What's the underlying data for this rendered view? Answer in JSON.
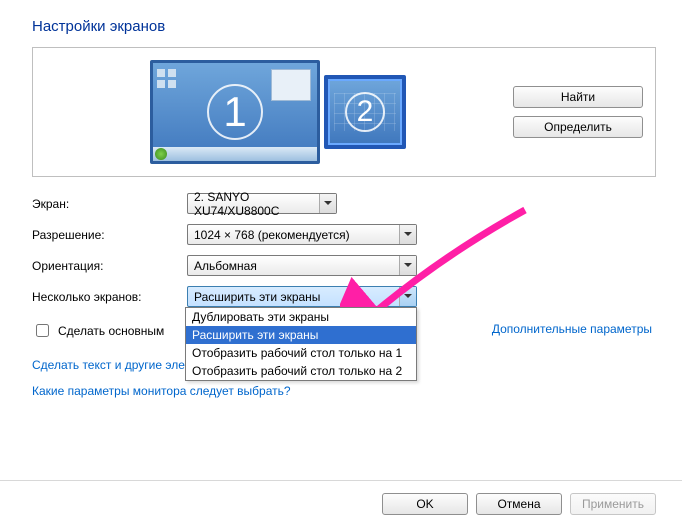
{
  "title": "Настройки экранов",
  "buttons": {
    "find": "Найти",
    "identify": "Определить",
    "ok": "OK",
    "cancel": "Отмена",
    "apply": "Применить"
  },
  "monitors": {
    "one": "1",
    "two": "2"
  },
  "labels": {
    "screen": "Экран:",
    "resolution": "Разрешение:",
    "orientation": "Ориентация:",
    "multiple": "Несколько экранов:",
    "make_primary": "Сделать основным"
  },
  "values": {
    "screen": "2. SANYO XU74/XU8800C",
    "resolution": "1024 × 768 (рекомендуется)",
    "orientation": "Альбомная",
    "multiple": "Расширить эти экраны"
  },
  "dropdown_options": [
    "Дублировать эти экраны",
    "Расширить эти экраны",
    "Отобразить рабочий стол только на 1",
    "Отобразить рабочий стол только на 2"
  ],
  "dropdown_selected_index": 1,
  "links": {
    "text_size": "Сделать текст и другие элементы",
    "which_monitor": "Какие параметры монитора следует выбрать?",
    "advanced": "Дополнительные параметры"
  }
}
